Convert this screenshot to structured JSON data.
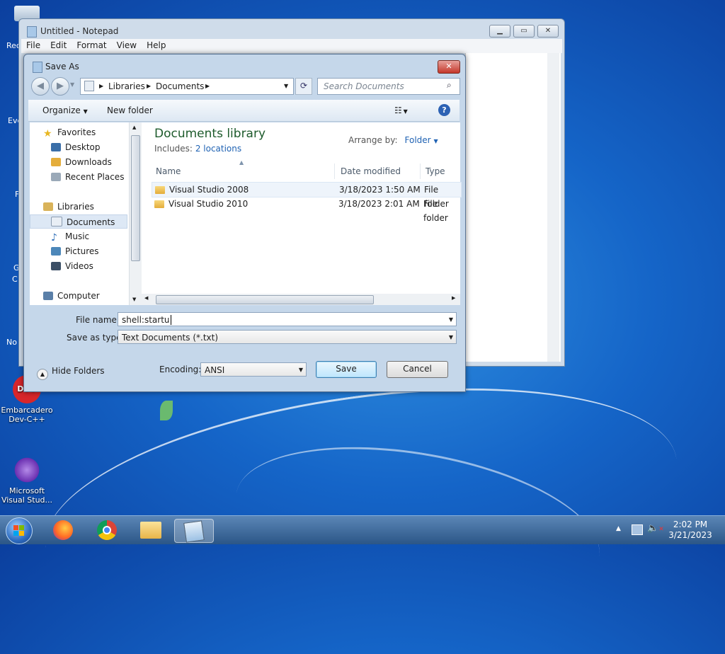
{
  "desktop": {
    "icons": [
      {
        "label": "Embarcadero Dev-C++"
      },
      {
        "label": "Microsoft Visual Stud..."
      }
    ],
    "partial_labels": [
      "Rec",
      "Eve",
      "F",
      "G",
      "C",
      "No"
    ]
  },
  "notepad": {
    "title": "Untitled - Notepad",
    "menu": [
      "File",
      "Edit",
      "Format",
      "View",
      "Help"
    ]
  },
  "dialog": {
    "title": "Save As",
    "breadcrumb": [
      "Libraries",
      "Documents"
    ],
    "search_placeholder": "Search Documents",
    "toolbar": {
      "organize": "Organize",
      "new_folder": "New folder"
    },
    "nav": {
      "favorites": "Favorites",
      "favorites_items": [
        "Desktop",
        "Downloads",
        "Recent Places"
      ],
      "libraries": "Libraries",
      "libraries_items": [
        "Documents",
        "Music",
        "Pictures",
        "Videos"
      ],
      "computer": "Computer"
    },
    "library": {
      "title": "Documents library",
      "includes_label": "Includes:",
      "includes_link": "2 locations",
      "arrange_label": "Arrange by:",
      "arrange_value": "Folder"
    },
    "columns": [
      "Name",
      "Date modified",
      "Type"
    ],
    "files": [
      {
        "name": "Visual Studio 2008",
        "date": "3/18/2023 1:50 AM",
        "type": "File folder"
      },
      {
        "name": "Visual Studio 2010",
        "date": "3/18/2023 2:01 AM",
        "type": "File folder"
      }
    ],
    "file_name_label": "File name:",
    "file_name_value": "shell:startu",
    "save_type_label": "Save as type:",
    "save_type_value": "Text Documents (*.txt)",
    "hide_folders": "Hide Folders",
    "encoding_label": "Encoding:",
    "encoding_value": "ANSI",
    "save": "Save",
    "cancel": "Cancel"
  },
  "taskbar": {
    "time": "2:02 PM",
    "date": "3/21/2023"
  }
}
